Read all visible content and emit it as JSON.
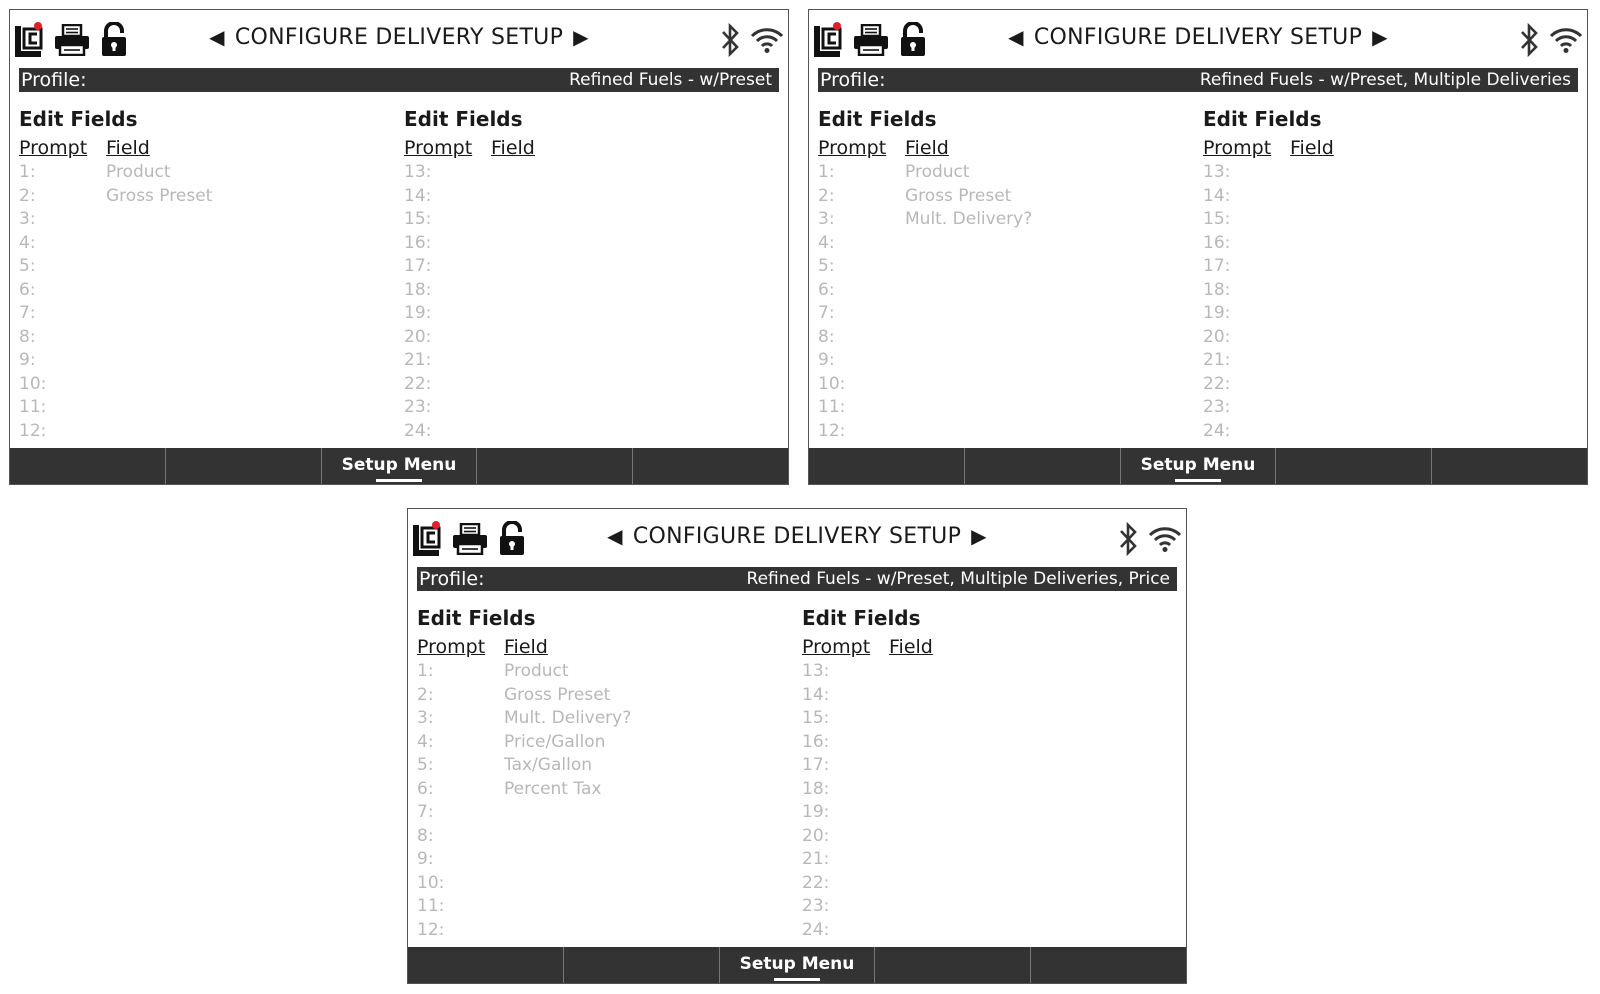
{
  "screens": [
    {
      "title": "CONFIGURE DELIVERY SETUP",
      "profile_label": "Profile:",
      "profile_value": "Refined Fuels - w/Preset",
      "left": {
        "title": "Edit Fields",
        "prompt_header": "Prompt",
        "field_header": "Field",
        "rows": [
          {
            "num": "1:",
            "field": "Product"
          },
          {
            "num": "2:",
            "field": "Gross Preset"
          },
          {
            "num": "3:",
            "field": ""
          },
          {
            "num": "4:",
            "field": ""
          },
          {
            "num": "5:",
            "field": ""
          },
          {
            "num": "6:",
            "field": ""
          },
          {
            "num": "7:",
            "field": ""
          },
          {
            "num": "8:",
            "field": ""
          },
          {
            "num": "9:",
            "field": ""
          },
          {
            "num": "10:",
            "field": ""
          },
          {
            "num": "11:",
            "field": ""
          },
          {
            "num": "12:",
            "field": ""
          }
        ]
      },
      "right": {
        "title": "Edit Fields",
        "prompt_header": "Prompt",
        "field_header": "Field",
        "rows": [
          {
            "num": "13:",
            "field": ""
          },
          {
            "num": "14:",
            "field": ""
          },
          {
            "num": "15:",
            "field": ""
          },
          {
            "num": "16:",
            "field": ""
          },
          {
            "num": "17:",
            "field": ""
          },
          {
            "num": "18:",
            "field": ""
          },
          {
            "num": "19:",
            "field": ""
          },
          {
            "num": "20:",
            "field": ""
          },
          {
            "num": "21:",
            "field": ""
          },
          {
            "num": "22:",
            "field": ""
          },
          {
            "num": "23:",
            "field": ""
          },
          {
            "num": "24:",
            "field": ""
          }
        ]
      },
      "softkeys": [
        "",
        "",
        "Setup Menu",
        "",
        ""
      ]
    },
    {
      "title": "CONFIGURE DELIVERY SETUP",
      "profile_label": "Profile:",
      "profile_value": "Refined Fuels - w/Preset, Multiple Deliveries",
      "left": {
        "title": "Edit Fields",
        "prompt_header": "Prompt",
        "field_header": "Field",
        "rows": [
          {
            "num": "1:",
            "field": "Product"
          },
          {
            "num": "2:",
            "field": "Gross Preset"
          },
          {
            "num": "3:",
            "field": "Mult. Delivery?"
          },
          {
            "num": "4:",
            "field": ""
          },
          {
            "num": "5:",
            "field": ""
          },
          {
            "num": "6:",
            "field": ""
          },
          {
            "num": "7:",
            "field": ""
          },
          {
            "num": "8:",
            "field": ""
          },
          {
            "num": "9:",
            "field": ""
          },
          {
            "num": "10:",
            "field": ""
          },
          {
            "num": "11:",
            "field": ""
          },
          {
            "num": "12:",
            "field": ""
          }
        ]
      },
      "right": {
        "title": "Edit Fields",
        "prompt_header": "Prompt",
        "field_header": "Field",
        "rows": [
          {
            "num": "13:",
            "field": ""
          },
          {
            "num": "14:",
            "field": ""
          },
          {
            "num": "15:",
            "field": ""
          },
          {
            "num": "16:",
            "field": ""
          },
          {
            "num": "17:",
            "field": ""
          },
          {
            "num": "18:",
            "field": ""
          },
          {
            "num": "19:",
            "field": ""
          },
          {
            "num": "20:",
            "field": ""
          },
          {
            "num": "21:",
            "field": ""
          },
          {
            "num": "22:",
            "field": ""
          },
          {
            "num": "23:",
            "field": ""
          },
          {
            "num": "24:",
            "field": ""
          }
        ]
      },
      "softkeys": [
        "",
        "",
        "Setup Menu",
        "",
        ""
      ]
    },
    {
      "title": "CONFIGURE DELIVERY SETUP",
      "profile_label": "Profile:",
      "profile_value": "Refined Fuels - w/Preset, Multiple Deliveries, Price",
      "left": {
        "title": "Edit Fields",
        "prompt_header": "Prompt",
        "field_header": "Field",
        "rows": [
          {
            "num": "1:",
            "field": "Product"
          },
          {
            "num": "2:",
            "field": "Gross Preset"
          },
          {
            "num": "3:",
            "field": "Mult. Delivery?"
          },
          {
            "num": "4:",
            "field": "Price/Gallon"
          },
          {
            "num": "5:",
            "field": "Tax/Gallon"
          },
          {
            "num": "6:",
            "field": "Percent Tax"
          },
          {
            "num": "7:",
            "field": ""
          },
          {
            "num": "8:",
            "field": ""
          },
          {
            "num": "9:",
            "field": ""
          },
          {
            "num": "10:",
            "field": ""
          },
          {
            "num": "11:",
            "field": ""
          },
          {
            "num": "12:",
            "field": ""
          }
        ]
      },
      "right": {
        "title": "Edit Fields",
        "prompt_header": "Prompt",
        "field_header": "Field",
        "rows": [
          {
            "num": "13:",
            "field": ""
          },
          {
            "num": "14:",
            "field": ""
          },
          {
            "num": "15:",
            "field": ""
          },
          {
            "num": "16:",
            "field": ""
          },
          {
            "num": "17:",
            "field": ""
          },
          {
            "num": "18:",
            "field": ""
          },
          {
            "num": "19:",
            "field": ""
          },
          {
            "num": "20:",
            "field": ""
          },
          {
            "num": "21:",
            "field": ""
          },
          {
            "num": "22:",
            "field": ""
          },
          {
            "num": "23:",
            "field": ""
          },
          {
            "num": "24:",
            "field": ""
          }
        ]
      },
      "softkeys": [
        "",
        "",
        "Setup Menu",
        "",
        ""
      ]
    }
  ],
  "icons": {
    "left": [
      "lc-logo-icon",
      "printer-icon",
      "unlocked-padlock-icon"
    ],
    "right": [
      "bluetooth-icon",
      "wifi-icon"
    ],
    "nav": [
      "prev-arrow-icon",
      "next-arrow-icon"
    ]
  },
  "colors": {
    "bar_background": "#333333",
    "logo_dot": "#e0202a",
    "inactive_text": "#b8b8b8"
  }
}
